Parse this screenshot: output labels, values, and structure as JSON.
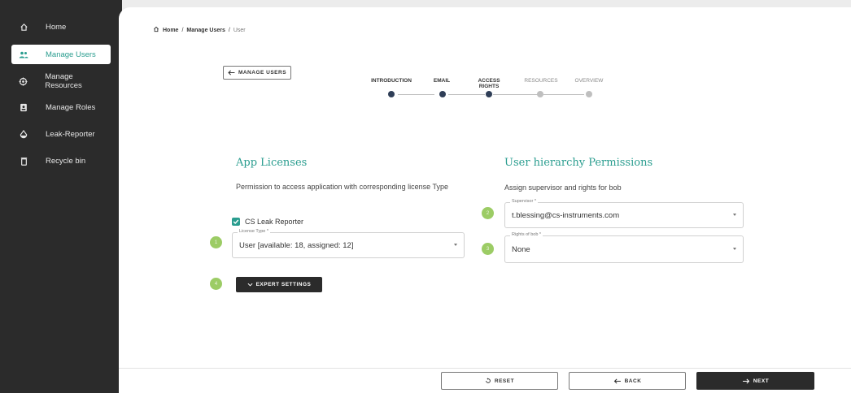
{
  "sidebar": {
    "items": [
      {
        "label": "Home",
        "icon": "home-icon"
      },
      {
        "label": "Manage Users",
        "icon": "users-icon",
        "active": true
      },
      {
        "label": "Manage Resources",
        "icon": "resources-icon"
      },
      {
        "label": "Manage Roles",
        "icon": "roles-icon"
      },
      {
        "label": "Leak-Reporter",
        "icon": "leak-icon"
      },
      {
        "label": "Recycle bin",
        "icon": "trash-icon"
      }
    ]
  },
  "breadcrumb": {
    "home": "Home",
    "sep1": "/",
    "users": "Manage Users",
    "sep2": "/",
    "current": "User"
  },
  "back_to_users": "MANAGE USERS",
  "stepper": {
    "steps": [
      {
        "label": "INTRODUCTION",
        "state": "done"
      },
      {
        "label": "EMAIL",
        "state": "done"
      },
      {
        "label": "ACCESS RIGHTS",
        "state": "current"
      },
      {
        "label": "RESOURCES",
        "state": "todo"
      },
      {
        "label": "OVERVIEW",
        "state": "todo"
      }
    ]
  },
  "licenses": {
    "title": "App Licenses",
    "description": "Permission to access application with corresponding license Type",
    "app_name": "CS Leak Reporter",
    "app_checked": true,
    "license_type_label": "License Type *",
    "license_type_value": "User [available: 18, assigned: 12]",
    "expert_settings": "EXPERT SETTINGS"
  },
  "hierarchy": {
    "title": "User hierarchy Permissions",
    "description": "Assign supervisor and rights for bob",
    "supervisor_label": "Supervisor *",
    "supervisor_value": "t.blessing@cs-instruments.com",
    "rights_label": "Rights of bob *",
    "rights_value": "None"
  },
  "badges": [
    "1",
    "2",
    "3",
    "4"
  ],
  "footer": {
    "reset": "RESET",
    "back": "BACK",
    "next": "NEXT"
  },
  "colors": {
    "accent": "#2a9d8f",
    "sidebar": "#2b2b2b",
    "badge": "#9ccc65",
    "step_done": "#2f3e57"
  }
}
